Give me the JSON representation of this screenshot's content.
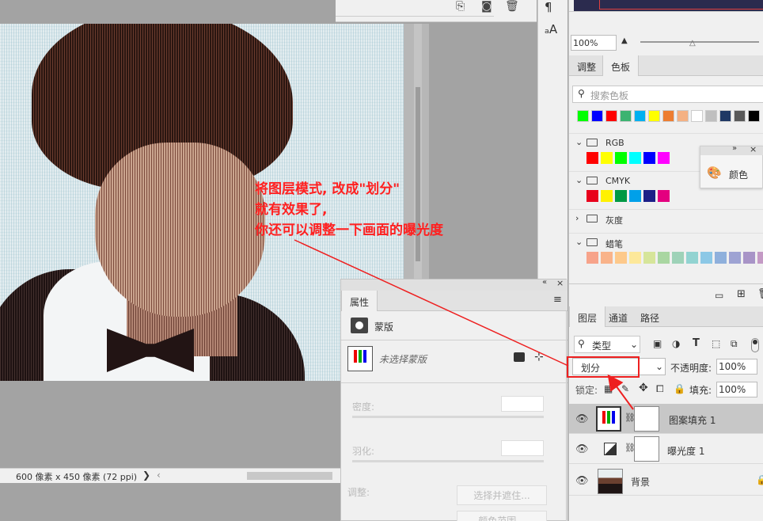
{
  "canvas": {
    "status_text": "600 像素 x 450 像素 (72 ppi)",
    "arrow": "❯",
    "arrow_left": "‹"
  },
  "annotation": {
    "line1": "将图层模式, 改成\"划分\"",
    "line2": "就有效果了,",
    "line3": "你还可以调整一下画面的曝光度",
    "color": "#ff2020"
  },
  "navigator": {
    "zoom": "100%"
  },
  "swatches_panel": {
    "tabs": [
      "调整",
      "色板"
    ],
    "active_tab": "色板",
    "search_placeholder": "搜索色板",
    "recent_colors": [
      "#00ff00",
      "#0000ff",
      "#ff0000",
      "#3cb371",
      "#00b0f0",
      "#ffff00",
      "#ed7d31",
      "#f4b183",
      "#ffffff",
      "#bfbfbf",
      "#1f3864",
      "#595959",
      "#000000"
    ],
    "groups": [
      {
        "name": "RGB",
        "expanded": true,
        "colors": [
          "#ff0000",
          "#ffff00",
          "#00ff00",
          "#00ffff",
          "#0000ff",
          "#ff00ff"
        ]
      },
      {
        "name": "CMYK",
        "expanded": true,
        "colors": [
          "#e8001c",
          "#fff100",
          "#009944",
          "#00a0e9",
          "#1d2088",
          "#e4007f"
        ]
      },
      {
        "name": "灰度",
        "expanded": false,
        "colors": []
      },
      {
        "name": "蜡笔",
        "expanded": true,
        "colors": [
          "#f7a38a",
          "#f9b38a",
          "#fdc98b",
          "#fde89a",
          "#d6e59a",
          "#a9d6a1",
          "#9ed2b8",
          "#92d3d1",
          "#8cc8e6",
          "#8fb0dc",
          "#9ea3d3",
          "#a894c7",
          "#c49ac5",
          "#f29fc1",
          "#f3a3b0"
        ]
      }
    ]
  },
  "color_flyout": {
    "label": "颜色",
    "collapse": "»",
    "close": "×"
  },
  "properties": {
    "tab": "属性",
    "section": "蒙版",
    "mask_status": "未选择蒙版",
    "density_label": "密度:",
    "feather_label": "羽化:",
    "adjust_label": "调整:",
    "select_mask_button": "选择并遮住...",
    "color_range_button": "颜色范围..."
  },
  "layers_panel": {
    "tabs": [
      "图层",
      "通道",
      "路径"
    ],
    "active_tab": "图层",
    "filter_kind": "类型",
    "blend_mode": "划分",
    "opacity_label": "不透明度:",
    "opacity": "100%",
    "lock_label": "锁定:",
    "fill_label": "填充:",
    "fill": "100%",
    "layers": [
      {
        "name": "图案填充 1",
        "selected": true
      },
      {
        "name": "曝光度 1",
        "selected": false
      },
      {
        "name": "背景",
        "selected": false
      }
    ]
  }
}
